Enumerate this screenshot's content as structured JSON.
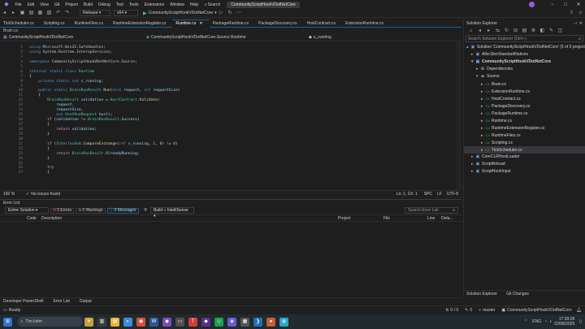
{
  "menu": [
    "File",
    "Edit",
    "View",
    "Git",
    "Project",
    "Build",
    "Debug",
    "Test",
    "Tools",
    "Extensions",
    "Window",
    "Help"
  ],
  "search_label": "Search",
  "window_title": "CommunityScriptHookVDotNetCore",
  "toolbar": {
    "config": "Release",
    "platform": "x64",
    "start_target": "CommunityScriptHookVDotNetCore"
  },
  "tabs": [
    "TickScheduler.cs",
    "Scripting.cs",
    "RuntimeFiles.cs",
    "RuntimeExtensionRegister.cs",
    "Runtime.cs",
    "PackageRuntime.cs",
    "PackageDiscovery.cs",
    "HostContract.cs",
    "ExtensionRuntime.cs"
  ],
  "active_tab": "Runtime.cs",
  "brain_tab": "Brain.cs",
  "navbar": {
    "project": "CommunityScriptHookVDotNetCore",
    "type": "CommunityScriptHookVDotNetCore.Source.Runtime",
    "member": "s_running"
  },
  "line_numbers": [
    "1",
    "2",
    "3",
    "4",
    "5",
    "6",
    "7",
    "8",
    "9",
    "10",
    "11",
    "12",
    "13",
    "14",
    "15",
    "16",
    "17",
    "18",
    "19",
    "20",
    "21",
    "22",
    "23",
    "24",
    "25",
    "26",
    "27"
  ],
  "editor_status": {
    "zoom": "100 %",
    "issues": "No issues found",
    "position": "Ln: 1, Ch: 1",
    "spc": "SPC",
    "lf": "LF",
    "encoding": "UTF-8"
  },
  "error_list": {
    "title": "Error List",
    "scope": "Entire Solution",
    "errors": "0 Errors",
    "warnings": "0 Warnings",
    "messages": "0 Messages",
    "build_filter": "Build + IntelliSense",
    "search_placeholder": "Search Error List",
    "columns": {
      "code": "Code",
      "description": "Description",
      "project": "Project",
      "file": "File",
      "line": "Line",
      "details": "Deta..."
    }
  },
  "bottom_tabs": [
    "Developer PowerShell",
    "Error List",
    "Output"
  ],
  "solution_explorer": {
    "title": "Solution Explorer",
    "search_placeholder": "Search Solution Explorer (Ctrl+;)",
    "items": [
      {
        "label": "Solution 'CommunityScriptHookVDotNetCore' (5 of 5 projects)",
        "icon": "solution-icon",
        "indent": 0,
        "chevron": "▴"
      },
      {
        "label": "AllocStorStandardNatives",
        "icon": "project-icon",
        "indent": 1,
        "chevron": "▸"
      },
      {
        "label": "CommunityScriptHookVDotNetCore",
        "icon": "project-icon",
        "indent": 1,
        "chevron": "▾",
        "bold": true
      },
      {
        "label": "Dependencies",
        "icon": "dependencies-icon",
        "indent": 2,
        "chevron": "▸"
      },
      {
        "label": "Source",
        "icon": "folder-icon",
        "indent": 2,
        "chevron": "▾"
      },
      {
        "label": "Brain.cs",
        "icon": "csharp-file-icon",
        "indent": 3,
        "chevron": "▸"
      },
      {
        "label": "ExtensionRuntime.cs",
        "icon": "csharp-file-icon",
        "indent": 3,
        "chevron": "▸"
      },
      {
        "label": "HostContract.cs",
        "icon": "csharp-file-icon",
        "indent": 3,
        "chevron": "▸"
      },
      {
        "label": "PackageDiscovery.cs",
        "icon": "csharp-file-icon",
        "indent": 3,
        "chevron": "▸"
      },
      {
        "label": "PackageRuntime.cs",
        "icon": "csharp-file-icon",
        "indent": 3,
        "chevron": "▸"
      },
      {
        "label": "Runtime.cs",
        "icon": "csharp-file-icon",
        "indent": 3,
        "chevron": "▸"
      },
      {
        "label": "RuntimeExtensionRegister.cs",
        "icon": "csharp-file-icon",
        "indent": 3,
        "chevron": "▸"
      },
      {
        "label": "RuntimeFiles.cs",
        "icon": "csharp-file-icon",
        "indent": 3,
        "chevron": "▸"
      },
      {
        "label": "Scripting.cs",
        "icon": "csharp-file-icon",
        "indent": 3,
        "chevron": "▸"
      },
      {
        "label": "TickScheduler.cs",
        "icon": "csharp-file-icon",
        "indent": 3,
        "chevron": "▸",
        "selected": true
      },
      {
        "label": "CoreCLRHostLoader",
        "icon": "project-icon",
        "indent": 1,
        "chevron": "▸"
      },
      {
        "label": "ScriptReload",
        "icon": "project-icon",
        "indent": 1,
        "chevron": "▸"
      },
      {
        "label": "ScriptHookInput",
        "icon": "project-icon",
        "indent": 1,
        "chevron": "▸"
      }
    ],
    "bottom_tabs": [
      "Solution Explorer",
      "Git Changes"
    ]
  },
  "status": {
    "ready": "Ready",
    "sync": "0 / 0",
    "pencil": "0",
    "branch": "master",
    "repo": "CommunityScriptHookVDotNetCore"
  },
  "taskbar": {
    "search_placeholder": "Tìm kiếm",
    "lang": "ENG",
    "time": "17:39:28",
    "date": "02/08/2025"
  },
  "colors": {
    "accent": "#0e639c",
    "keyword": "#569cd6",
    "type": "#4ec9b0",
    "method": "#dcdcaa",
    "param": "#9cdcfe"
  }
}
